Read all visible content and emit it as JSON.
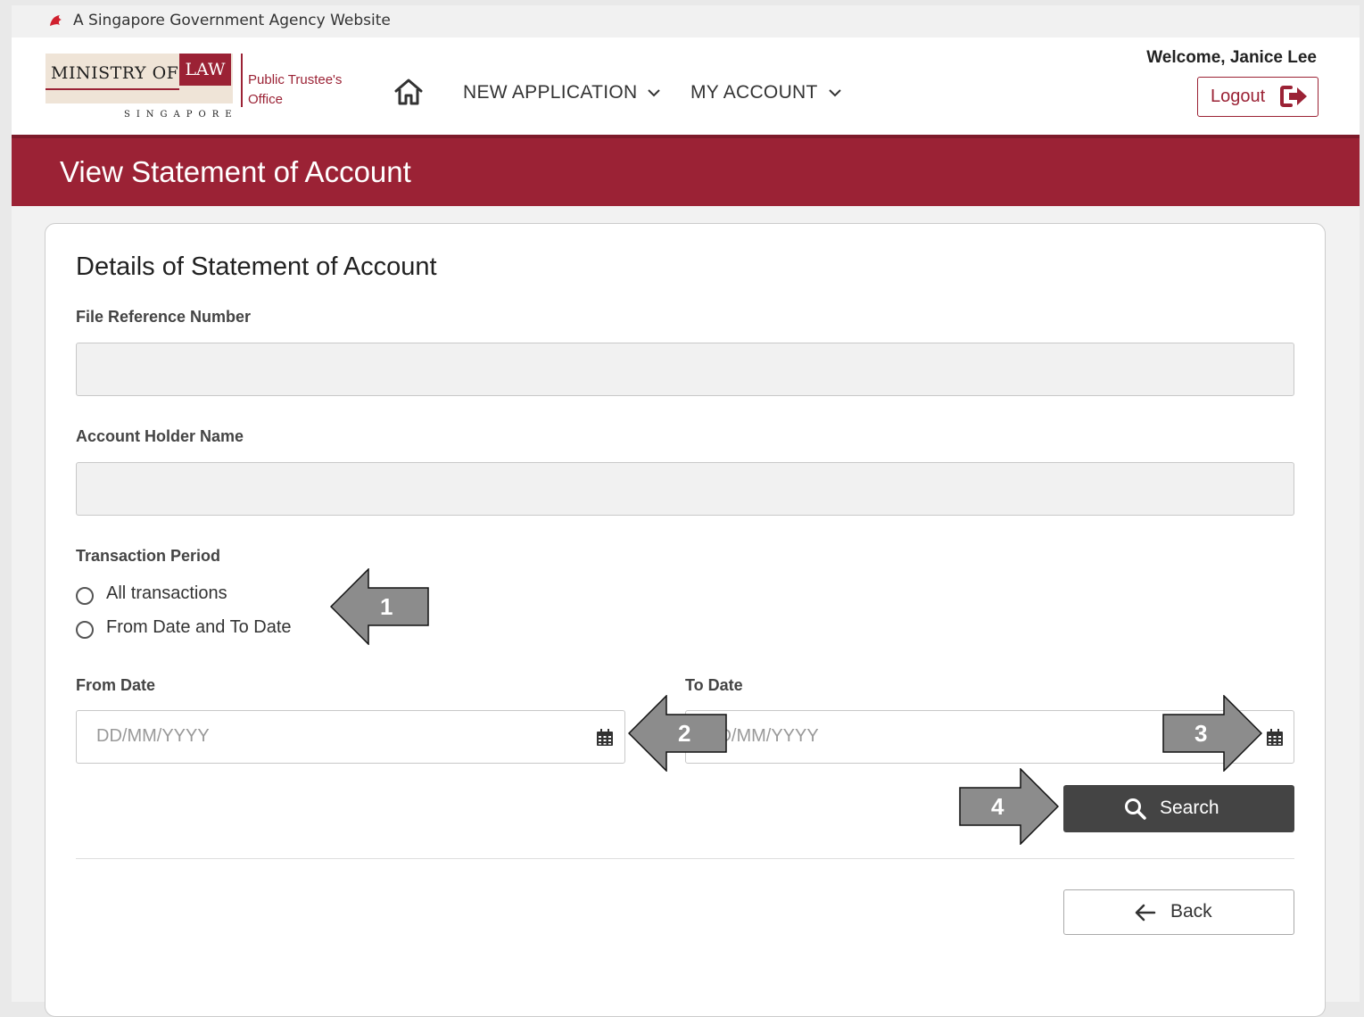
{
  "gov_banner": {
    "text": "A Singapore Government Agency Website"
  },
  "logo": {
    "ministry_text": "MINISTRY OF",
    "law_text": "LAW",
    "country": "SINGAPORE",
    "office_line1": "Public Trustee's",
    "office_line2": "Office"
  },
  "nav": {
    "home_icon": "home-icon",
    "items": [
      {
        "label": "NEW APPLICATION",
        "icon": "chevron-down-icon"
      },
      {
        "label": "MY ACCOUNT",
        "icon": "chevron-down-icon"
      }
    ]
  },
  "user": {
    "welcome": "Welcome, Janice Lee",
    "logout_label": "Logout",
    "logout_icon": "sign-out-icon"
  },
  "banner": {
    "title": "View Statement of Account"
  },
  "form": {
    "heading": "Details of Statement of Account",
    "file_ref_label": "File Reference Number",
    "file_ref_value": "",
    "holder_label": "Account Holder Name",
    "holder_value": "",
    "period_label": "Transaction Period",
    "period_options": [
      "All transactions",
      "From Date and To Date"
    ],
    "from_label": "From Date",
    "from_placeholder": "DD/MM/YYYY",
    "to_label": "To Date",
    "to_placeholder": "DD/MM/YYYY",
    "search_label": "Search",
    "back_label": "Back"
  },
  "callouts": [
    "1",
    "2",
    "3",
    "4"
  ],
  "colors": {
    "brand": "#9b2235",
    "search_button": "#444444",
    "callout_arrow": "#8c8c8c"
  }
}
